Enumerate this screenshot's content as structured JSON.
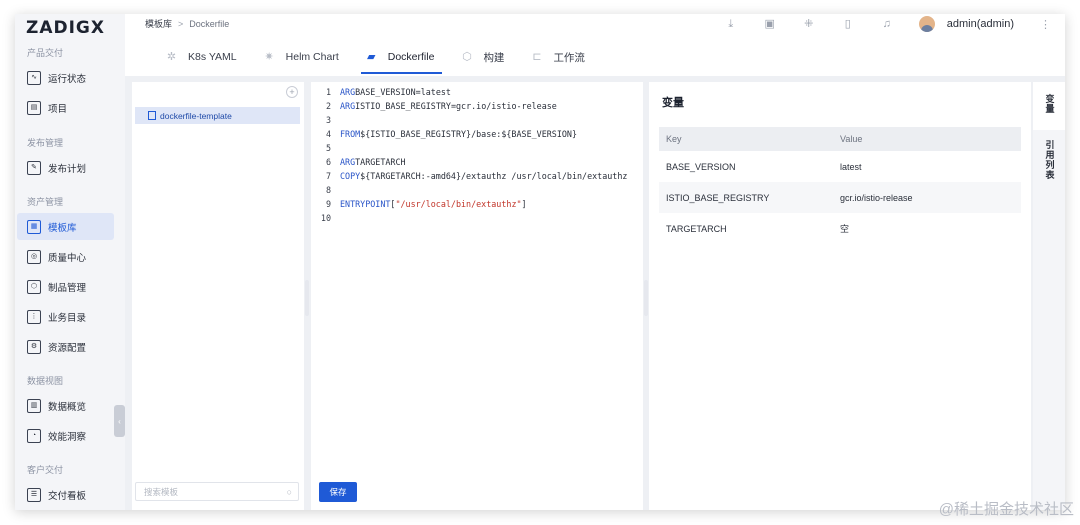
{
  "app": {
    "logo": "ZADIGX"
  },
  "sidebar": {
    "sections": [
      {
        "title": "产品交付",
        "items": [
          {
            "label": "运行状态",
            "icon": "pulse-icon"
          },
          {
            "label": "项目",
            "icon": "project-icon"
          }
        ]
      },
      {
        "title": "发布管理",
        "items": [
          {
            "label": "发布计划",
            "icon": "release-plan-icon"
          }
        ]
      },
      {
        "title": "资产管理",
        "items": [
          {
            "label": "模板库",
            "icon": "template-icon",
            "active": true
          },
          {
            "label": "质量中心",
            "icon": "quality-icon"
          },
          {
            "label": "制品管理",
            "icon": "artifact-icon"
          },
          {
            "label": "业务目录",
            "icon": "catalog-icon"
          },
          {
            "label": "资源配置",
            "icon": "resource-icon"
          }
        ]
      },
      {
        "title": "数据视图",
        "items": [
          {
            "label": "数据概览",
            "icon": "chart-icon"
          },
          {
            "label": "效能洞察",
            "icon": "insight-icon"
          }
        ]
      },
      {
        "title": "客户交付",
        "items": [
          {
            "label": "交付看板",
            "icon": "board-icon"
          }
        ]
      }
    ]
  },
  "header": {
    "breadcrumb": {
      "root": "模板库",
      "separator": ">",
      "current": "Dockerfile"
    },
    "tabs": [
      {
        "label": "K8s YAML"
      },
      {
        "label": "Helm Chart"
      },
      {
        "label": "Dockerfile",
        "active": true
      },
      {
        "label": "构建"
      },
      {
        "label": "工作流"
      }
    ],
    "user": "admin(admin)"
  },
  "templates": {
    "items": [
      "dockerfile-template"
    ],
    "search_placeholder": "搜索模板"
  },
  "editor": {
    "lines": [
      {
        "n": "1",
        "kw": "ARG",
        "rest": " BASE_VERSION=latest"
      },
      {
        "n": "2",
        "kw": "ARG",
        "rest": " ISTIO_BASE_REGISTRY=gcr.io/istio-release"
      },
      {
        "n": "3",
        "kw": "",
        "rest": ""
      },
      {
        "n": "4",
        "kw": "FROM",
        "rest": " ${ISTIO_BASE_REGISTRY}/base:${BASE_VERSION}"
      },
      {
        "n": "5",
        "kw": "",
        "rest": ""
      },
      {
        "n": "6",
        "kw": "ARG",
        "rest": " TARGETARCH"
      },
      {
        "n": "7",
        "kw": "COPY",
        "rest": " ${TARGETARCH:-amd64}/extauthz /usr/local/bin/extauthz"
      },
      {
        "n": "8",
        "kw": "",
        "rest": ""
      },
      {
        "n": "9",
        "kw": "ENTRYPOINT",
        "rest": " [",
        "str": "\"/usr/local/bin/extauthz\"",
        "tail": "]"
      },
      {
        "n": "10",
        "kw": "",
        "rest": ""
      }
    ],
    "save_label": "保存"
  },
  "variables": {
    "title": "变量",
    "columns": [
      "Key",
      "Value"
    ],
    "rows": [
      {
        "key": "BASE_VERSION",
        "value": "latest"
      },
      {
        "key": "ISTIO_BASE_REGISTRY",
        "value": "gcr.io/istio-release"
      },
      {
        "key": "TARGETARCH",
        "value": "空"
      }
    ]
  },
  "side_tabs": [
    "变量",
    "引用列表"
  ],
  "watermark": "@稀土掘金技术社区"
}
